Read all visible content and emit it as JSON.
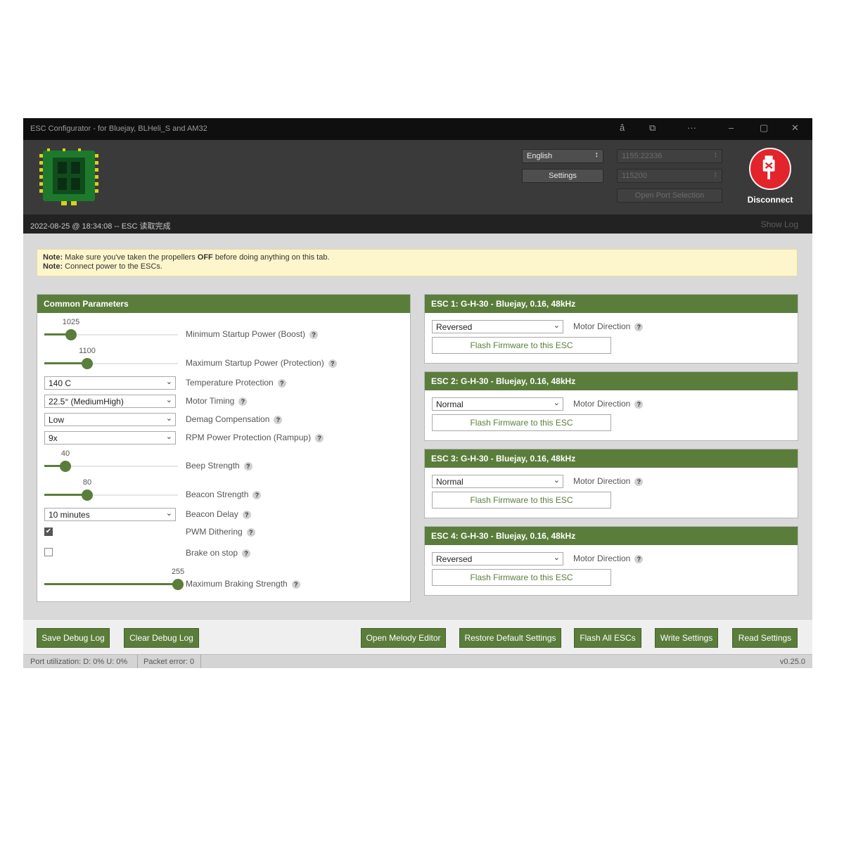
{
  "window": {
    "title": "ESC Configurator - for Bluejay, BLHeli_S and AM32",
    "controls": [
      "ā́",
      "⧉",
      "···",
      "–",
      "▢",
      "✕"
    ]
  },
  "header": {
    "language": "English",
    "settings_label": "Settings",
    "port": "1155:22336",
    "baud": "115200",
    "open_port_label": "Open Port Selection",
    "disconnect_label": "Disconnect",
    "accent_color": "#e3242b"
  },
  "log": {
    "message": "2022-08-25 @ 18:34:08 -- ESC 读取完成",
    "show_log_label": "Show Log"
  },
  "note": {
    "line1_bold": "Note:",
    "line1_text": " Make sure you've taken the propellers ",
    "line1_off": "OFF",
    "line1_rest": " before doing anything on this tab.",
    "line2_bold": "Note:",
    "line2_text": " Connect power to the ESCs."
  },
  "common": {
    "title": "Common Parameters",
    "min_startup": {
      "value": "1025",
      "label": "Minimum Startup Power (Boost)",
      "fraction": 0.2
    },
    "max_startup": {
      "value": "1100",
      "label": "Maximum Startup Power (Protection)",
      "fraction": 0.32
    },
    "temperature": {
      "value": "140 C",
      "label": "Temperature Protection"
    },
    "motor_timing": {
      "value": "22.5° (MediumHigh)",
      "label": "Motor Timing"
    },
    "demag": {
      "value": "Low",
      "label": "Demag Compensation"
    },
    "rpm_protection": {
      "value": "9x",
      "label": "RPM Power Protection (Rampup)"
    },
    "beep": {
      "value": "40",
      "label": "Beep Strength",
      "fraction": 0.16
    },
    "beacon": {
      "value": "80",
      "label": "Beacon Strength",
      "fraction": 0.32
    },
    "beacon_delay": {
      "value": "10 minutes",
      "label": "Beacon Delay"
    },
    "pwm_dithering": {
      "checked": true,
      "label": "PWM Dithering"
    },
    "brake_on_stop": {
      "checked": false,
      "label": "Brake on stop"
    },
    "braking_strength": {
      "value": "255",
      "label": "Maximum Braking Strength",
      "fraction": 1.0
    },
    "help_glyph": "?",
    "check_glyph": "✔"
  },
  "escs": [
    {
      "title": "ESC 1: G-H-30 - Bluejay, 0.16, 48kHz",
      "direction": "Reversed",
      "direction_label": "Motor Direction",
      "flash_label": "Flash Firmware to this ESC"
    },
    {
      "title": "ESC 2: G-H-30 - Bluejay, 0.16, 48kHz",
      "direction": "Normal",
      "direction_label": "Motor Direction",
      "flash_label": "Flash Firmware to this ESC"
    },
    {
      "title": "ESC 3: G-H-30 - Bluejay, 0.16, 48kHz",
      "direction": "Normal",
      "direction_label": "Motor Direction",
      "flash_label": "Flash Firmware to this ESC"
    },
    {
      "title": "ESC 4: G-H-30 - Bluejay, 0.16, 48kHz",
      "direction": "Reversed",
      "direction_label": "Motor Direction",
      "flash_label": "Flash Firmware to this ESC"
    }
  ],
  "footer": {
    "save_debug": "Save Debug Log",
    "clear_debug": "Clear Debug Log",
    "melody": "Open Melody Editor",
    "restore": "Restore Default Settings",
    "flash_all": "Flash All ESCs",
    "write": "Write Settings",
    "read": "Read Settings"
  },
  "status": {
    "port_util": "Port utilization: D: 0% U: 0%",
    "packet_error": "Packet error: 0",
    "version": "v0.25.0"
  },
  "colors": {
    "primary": "#5b7d3c",
    "note_bg": "#fdf5cc",
    "header_bg": "#3a3a3a"
  }
}
